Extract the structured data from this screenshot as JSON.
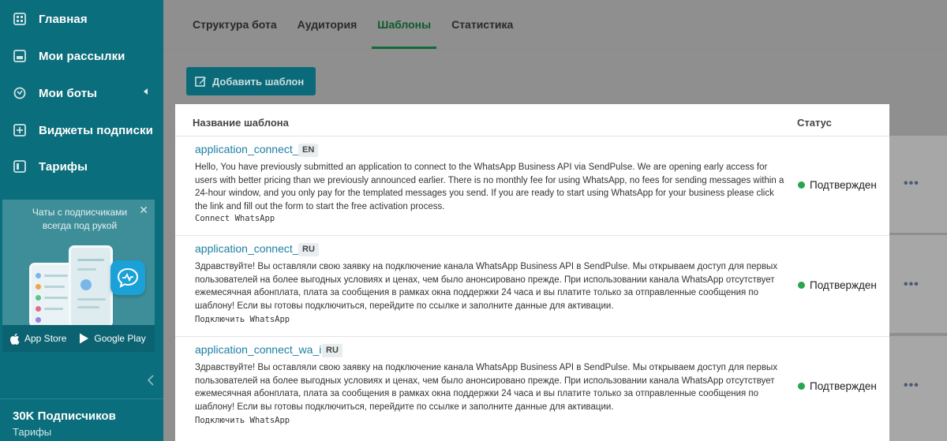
{
  "sidebar": {
    "items": [
      {
        "label": "Главная",
        "icon": "grid-icon"
      },
      {
        "label": "Мои рассылки",
        "icon": "mailing-icon"
      },
      {
        "label": "Мои боты",
        "icon": "bots-icon"
      },
      {
        "label": "Виджеты подписки",
        "icon": "widget-icon"
      },
      {
        "label": "Тарифы",
        "icon": "pricing-icon"
      }
    ],
    "promo": {
      "text": "Чаты с подписчиками всегда под рукой",
      "close": "✕",
      "app_store": "App Store",
      "google_play": "Google Play"
    },
    "subscribers": "30K Подписчиков",
    "tariffs_link": "Тарифы"
  },
  "tabs": [
    {
      "label": "Структура бота",
      "active": false
    },
    {
      "label": "Аудитория",
      "active": false
    },
    {
      "label": "Шаблоны",
      "active": true
    },
    {
      "label": "Статистика",
      "active": false
    }
  ],
  "add_button": "Добавить шаблон",
  "table": {
    "col_name": "Название шаблона",
    "col_status": "Статус",
    "rows": [
      {
        "name": "application_connect_wa",
        "lang": "EN",
        "text": "Hello, You have previously submitted an application to connect to the WhatsApp Business API via SendPulse. We are opening early access for users with better pricing than we previously announced earlier. There is no monthly fee for using WhatsApp, no fees for sending messages within a 24-hour window, and you only pay for the templated messages you send. If you are ready to start using WhatsApp for your business please click the link and fill out the form to start the free activation process.",
        "button": "Connect WhatsApp",
        "status": "Подтвержден"
      },
      {
        "name": "application_connect_wa",
        "lang": "RU",
        "text": "Здравствуйте! Вы оставляли свою заявку на подключение канала WhatsApp Business API в SendPulse. Мы открываем доступ для первых пользователей на более выгодных условиях и ценах, чем было анонсировано прежде. При использовании канала WhatsApp отсутствует ежемесячная абонплата, плата за сообщения в рамках окна поддержки 24 часа и вы платите только за отправленные сообщения по шаблону! Если вы готовы подключиться, перейдите по ссылке и заполните данные для активации.",
        "button": "Подключить WhatsApp",
        "status": "Подтвержден"
      },
      {
        "name": "application_connect_wa_img",
        "lang": "RU",
        "text": "Здравствуйте! Вы оставляли свою заявку на подключение канала WhatsApp Business API в SendPulse. Мы открываем доступ для первых пользователей на более выгодных условиях и ценах, чем было анонсировано прежде. При использовании канала WhatsApp отсутствует ежемесячная абонплата, плата за сообщения в рамках окна поддержки 24 часа и вы платите только за отправленные сообщения по шаблону! Если вы готовы подключиться, перейдите по ссылке и заполните данные для активации.",
        "button": "Подключить WhatsApp",
        "status": "Подтвержден"
      }
    ],
    "row_menu": "•••"
  },
  "colors": {
    "sidebar": "#0b6e7c",
    "accent_link": "#1b7fa3",
    "status_ok": "#27a54f",
    "active_tab": "#0e6d39"
  }
}
